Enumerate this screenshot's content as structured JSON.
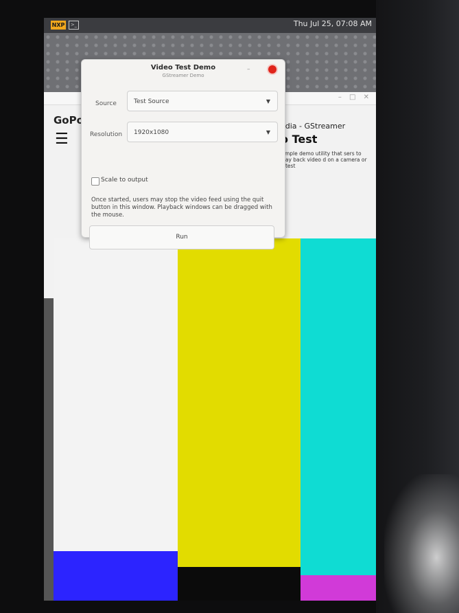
{
  "system_bar": {
    "clock": "Thu Jul 25, 07:08 AM",
    "logo": "NXP"
  },
  "background_app": {
    "title": "GoPo",
    "heading": "edia - GStreamer",
    "subheading": "o Test",
    "description": "simple demo utility that sers to play back video d on a camera or a test"
  },
  "dialog": {
    "title": "Video Test Demo",
    "subtitle": "GStreamer Demo",
    "source_label": "Source",
    "source_value": "Test Source",
    "resolution_label": "Resolution",
    "resolution_value": "1920x1080",
    "scale_label": "Scale to output",
    "note": "Once started, users may stop the video feed using the quit button in this window. Playback windows can be dragged with the mouse.",
    "run_label": "Run"
  },
  "test_pattern": {
    "top_colors": [
      "#f3f3f3",
      "#e2dc00",
      "#0fdcd3"
    ],
    "bottom_colors": [
      "#2c24ff",
      "#0b0b0b",
      "#d13ad8"
    ]
  },
  "icons": [
    "terminal-icon",
    "hamburger-menu-icon",
    "chevron-down-icon",
    "close-icon"
  ]
}
